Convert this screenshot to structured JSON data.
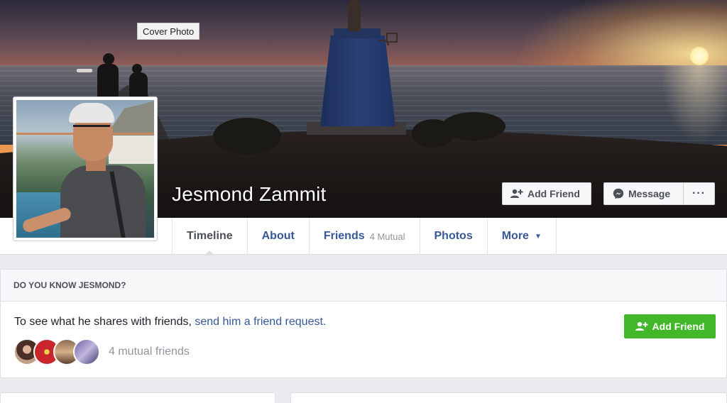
{
  "cover": {
    "tooltip": "Cover Photo"
  },
  "profile": {
    "name": "Jesmond Zammit"
  },
  "actions": {
    "add_friend_label": "Add Friend",
    "message_label": "Message",
    "more_label": "···"
  },
  "tabs": [
    {
      "label": "Timeline",
      "active": true
    },
    {
      "label": "About"
    },
    {
      "label": "Friends",
      "sub": "4 Mutual"
    },
    {
      "label": "Photos"
    },
    {
      "label": "More"
    }
  ],
  "prompt_card": {
    "header": "DO YOU KNOW JESMOND?",
    "text": "To see what he shares with friends,",
    "link": "send him a friend request.",
    "button_label": "Add Friend",
    "mutual_friends_text": "4 mutual friends"
  },
  "colors": {
    "link_blue": "#365899",
    "green_button": "#42b72a",
    "page_bg": "#e9ebee"
  },
  "icons": [
    "add-friend-icon",
    "messenger-icon",
    "more-dots-icon",
    "caret-down-icon"
  ]
}
